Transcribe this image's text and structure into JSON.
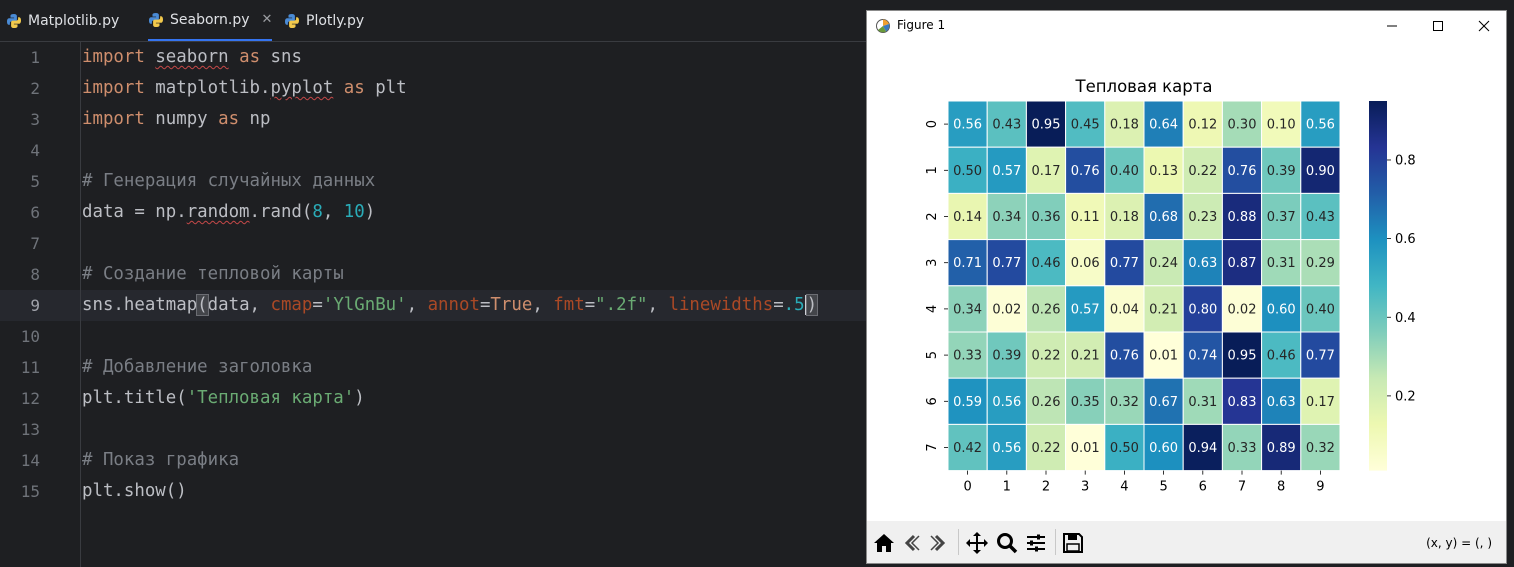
{
  "tabs": [
    {
      "label": "Matplotlib.py",
      "active": false
    },
    {
      "label": "Seaborn.py",
      "active": true
    },
    {
      "label": "Plotly.py",
      "active": false
    }
  ],
  "tab_close_glyph": "✕",
  "icons": {
    "tab": "python-file-icon",
    "window": "matplotlib-figure-icon",
    "toolbar": [
      "home-icon",
      "back-icon",
      "forward-icon",
      "pan-icon",
      "zoom-icon",
      "configure-subplots-icon",
      "save-icon"
    ]
  },
  "editor": {
    "current_line": 9,
    "lines": [
      {
        "n": "1",
        "text": "import seaborn as sns"
      },
      {
        "n": "2",
        "text": "import matplotlib.pyplot as plt"
      },
      {
        "n": "3",
        "text": "import numpy as np"
      },
      {
        "n": "4",
        "text": ""
      },
      {
        "n": "5",
        "text": "# Генерация случайных данных"
      },
      {
        "n": "6",
        "text": "data = np.random.rand(8, 10)"
      },
      {
        "n": "7",
        "text": ""
      },
      {
        "n": "8",
        "text": "# Создание тепловой карты"
      },
      {
        "n": "9",
        "text": "sns.heatmap(data, cmap='YlGnBu', annot=True, fmt=\".2f\", linewidths=.5)"
      },
      {
        "n": "10",
        "text": ""
      },
      {
        "n": "11",
        "text": "# Добавление заголовка"
      },
      {
        "n": "12",
        "text": "plt.title('Тепловая карта')"
      },
      {
        "n": "13",
        "text": ""
      },
      {
        "n": "14",
        "text": "# Показ графика"
      },
      {
        "n": "15",
        "text": "plt.show()"
      }
    ]
  },
  "figure_window": {
    "title": "Figure 1",
    "coords_readout": "(x, y) = (, )"
  },
  "colors": {
    "accent": "#3574f0",
    "editor_bg": "#1e1f22"
  },
  "chart_data": {
    "type": "heatmap",
    "title": "Тепловая карта",
    "colormap": "YlGnBu",
    "x_ticks": [
      "0",
      "1",
      "2",
      "3",
      "4",
      "5",
      "6",
      "7",
      "8",
      "9"
    ],
    "y_ticks": [
      "0",
      "1",
      "2",
      "3",
      "4",
      "5",
      "6",
      "7"
    ],
    "values": [
      [
        0.56,
        0.43,
        0.95,
        0.45,
        0.18,
        0.64,
        0.12,
        0.3,
        0.1,
        0.56
      ],
      [
        0.5,
        0.57,
        0.17,
        0.76,
        0.4,
        0.13,
        0.22,
        0.76,
        0.39,
        0.9
      ],
      [
        0.14,
        0.34,
        0.36,
        0.11,
        0.18,
        0.68,
        0.23,
        0.88,
        0.37,
        0.43
      ],
      [
        0.71,
        0.77,
        0.46,
        0.06,
        0.77,
        0.24,
        0.63,
        0.87,
        0.31,
        0.29
      ],
      [
        0.34,
        0.02,
        0.26,
        0.57,
        0.04,
        0.21,
        0.8,
        0.02,
        0.6,
        0.4
      ],
      [
        0.33,
        0.39,
        0.22,
        0.21,
        0.76,
        0.01,
        0.74,
        0.95,
        0.46,
        0.77
      ],
      [
        0.59,
        0.56,
        0.26,
        0.35,
        0.32,
        0.67,
        0.31,
        0.83,
        0.63,
        0.17
      ],
      [
        0.42,
        0.56,
        0.22,
        0.01,
        0.5,
        0.6,
        0.94,
        0.33,
        0.89,
        0.32
      ]
    ],
    "value_format": ".2f",
    "colorbar_ticks": [
      "0.2",
      "0.4",
      "0.6",
      "0.8"
    ],
    "colorbar_tick_values": [
      0.2,
      0.4,
      0.6,
      0.8
    ],
    "colorbar_range": [
      0.01,
      0.95
    ]
  }
}
